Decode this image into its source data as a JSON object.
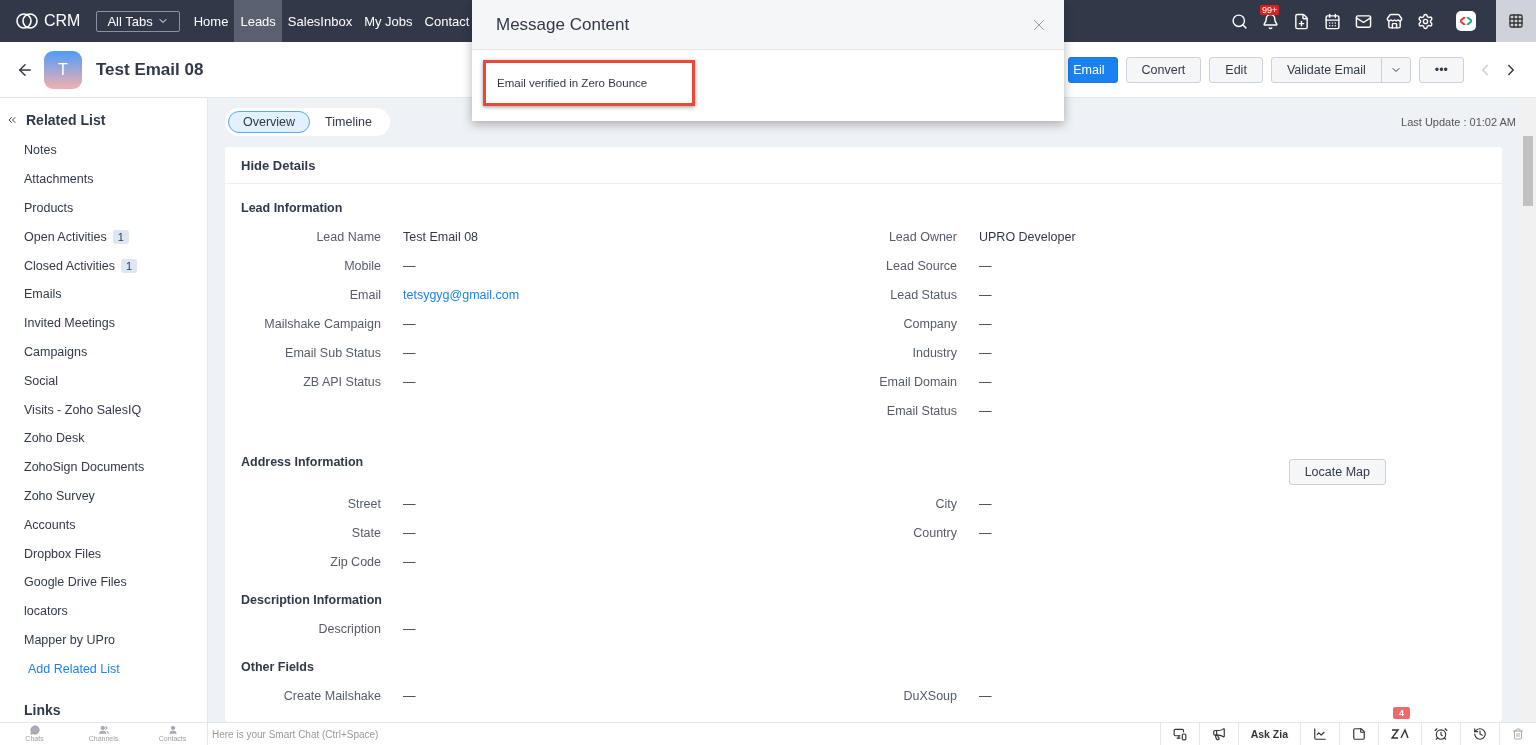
{
  "topbar": {
    "logo": "CRM",
    "all_tabs": "All Tabs",
    "tabs": [
      {
        "label": "Home",
        "selected": false
      },
      {
        "label": "Leads",
        "selected": true
      },
      {
        "label": "SalesInbox",
        "selected": false
      },
      {
        "label": "My Jobs",
        "selected": false
      },
      {
        "label": "Contact",
        "selected": false
      }
    ],
    "notification_badge": "99+"
  },
  "record": {
    "avatar_letter": "T",
    "title": "Test Email 08",
    "buttons": [
      {
        "label": "Email",
        "kind": "primary"
      },
      {
        "label": "Convert",
        "kind": "plain"
      },
      {
        "label": "Edit",
        "kind": "plain"
      },
      {
        "label": "Validate Email",
        "kind": "split"
      },
      {
        "label": "•••",
        "kind": "plain"
      }
    ]
  },
  "view_tabs": [
    {
      "label": "Overview",
      "selected": true
    },
    {
      "label": "Timeline",
      "selected": false
    }
  ],
  "last_update": "Last Update : 01:02 AM",
  "sidebar": {
    "title": "Related List",
    "items": [
      {
        "label": "Notes"
      },
      {
        "label": "Attachments"
      },
      {
        "label": "Products"
      },
      {
        "label": "Open Activities",
        "count": "1"
      },
      {
        "label": "Closed Activities",
        "count": "1"
      },
      {
        "label": "Emails"
      },
      {
        "label": "Invited Meetings"
      },
      {
        "label": "Campaigns"
      },
      {
        "label": "Social"
      },
      {
        "label": "Visits - Zoho SalesIQ"
      },
      {
        "label": "Zoho Desk"
      },
      {
        "label": "ZohoSign Documents"
      },
      {
        "label": "Zoho Survey"
      },
      {
        "label": "Accounts"
      },
      {
        "label": "Dropbox Files"
      },
      {
        "label": "Google Drive Files"
      },
      {
        "label": "locators"
      },
      {
        "label": "Mapper by UPro"
      }
    ],
    "add_link": "Add Related List",
    "links_title": "Links"
  },
  "details": {
    "toggle": "Hide Details",
    "sections": [
      {
        "title": "Lead Information",
        "rows": [
          [
            {
              "label": "Lead Name",
              "value": "Test Email 08"
            },
            {
              "label": "Lead Owner",
              "value": "UPRO Developer"
            }
          ],
          [
            {
              "label": "Mobile",
              "value": "—"
            },
            {
              "label": "Lead Source",
              "value": "—"
            }
          ],
          [
            {
              "label": "Email",
              "value": "tetsygyg@gmail.com",
              "kind": "link"
            },
            {
              "label": "Lead Status",
              "value": "—"
            }
          ],
          [
            {
              "label": "Mailshake Campaign",
              "value": "—"
            },
            {
              "label": "Company",
              "value": "—"
            }
          ],
          [
            {
              "label": "Email Sub Status",
              "value": "—"
            },
            {
              "label": "Industry",
              "value": "—"
            }
          ],
          [
            {
              "label": "ZB API Status",
              "value": "—"
            },
            {
              "label": "Email Domain",
              "value": "—"
            }
          ],
          [
            null,
            {
              "label": "Email Status",
              "value": "—"
            }
          ]
        ]
      },
      {
        "title": "Address Information",
        "action": "Locate Map",
        "rows": [
          [
            {
              "label": "Street",
              "value": "—"
            },
            {
              "label": "City",
              "value": "—"
            }
          ],
          [
            {
              "label": "State",
              "value": "—"
            },
            {
              "label": "Country",
              "value": "—"
            }
          ],
          [
            {
              "label": "Zip Code",
              "value": "—"
            },
            null
          ]
        ]
      },
      {
        "title": "Description Information",
        "rows": [
          [
            {
              "label": "Description",
              "value": "—"
            },
            null
          ]
        ]
      },
      {
        "title": "Other Fields",
        "rows": [
          [
            {
              "label": "Create Mailshake",
              "value": "—"
            },
            {
              "label": "DuXSoup",
              "value": "—"
            }
          ]
        ]
      }
    ]
  },
  "modal": {
    "title": "Message Content",
    "message": "Email verified in Zero Bounce"
  },
  "bottom_bar": {
    "apps": [
      "Chats",
      "Channels",
      "Contacts"
    ],
    "chat_placeholder": "Here is your Smart Chat (Ctrl+Space)",
    "ask_zia": "Ask Zia",
    "zia_badge": "4"
  }
}
